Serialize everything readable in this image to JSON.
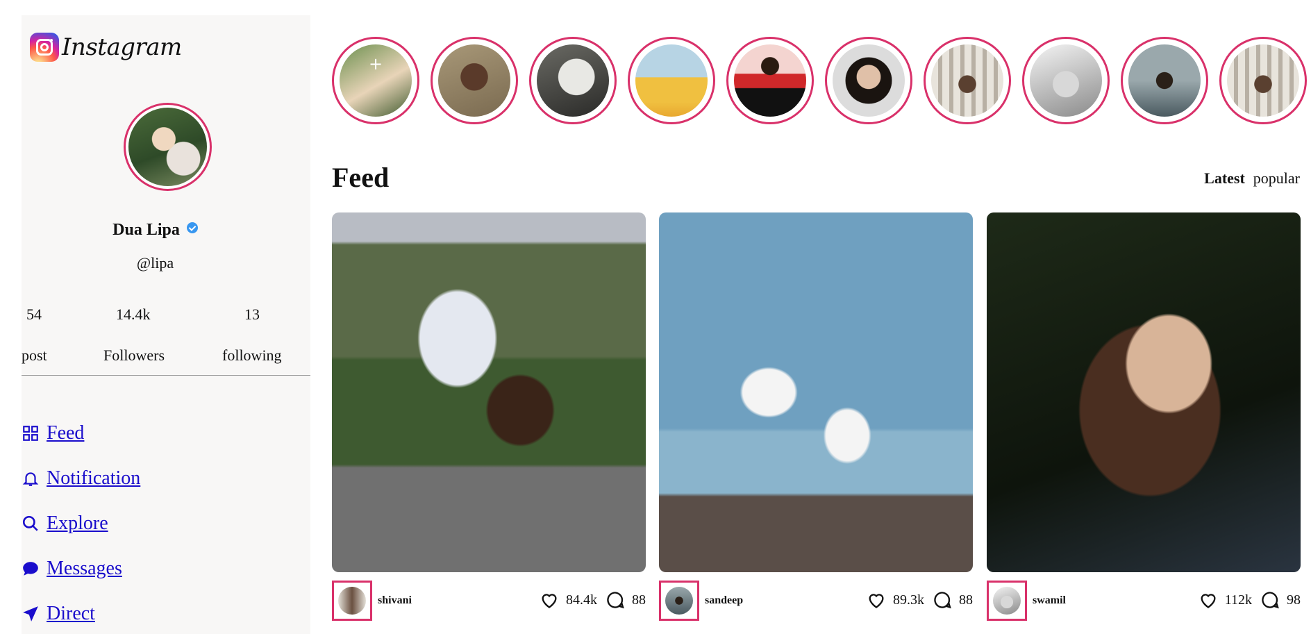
{
  "app": {
    "logo_text": "Instagram"
  },
  "profile": {
    "name": "Dua Lipa",
    "handle": "@lipa",
    "stats": [
      {
        "value": "54",
        "label": "post"
      },
      {
        "value": "14.4k",
        "label": "Followers"
      },
      {
        "value": "13",
        "label": "following"
      }
    ]
  },
  "nav": [
    {
      "label": "Feed",
      "icon": "grid-icon"
    },
    {
      "label": "Notification",
      "icon": "bell-icon"
    },
    {
      "label": "Explore",
      "icon": "search-icon"
    },
    {
      "label": "Messages",
      "icon": "chat-bubble-icon"
    },
    {
      "label": "Direct",
      "icon": "send-icon"
    }
  ],
  "stories_count": 10,
  "feed": {
    "title": "Feed",
    "tabs": [
      {
        "label": "Latest",
        "active": true
      },
      {
        "label": "popular",
        "active": false
      }
    ],
    "posts": [
      {
        "user": "shivani",
        "likes": "84.4k",
        "comments": "88"
      },
      {
        "user": "sandeep",
        "likes": "89.3k",
        "comments": "88"
      },
      {
        "user": "swamil",
        "likes": "112k",
        "comments": "98"
      }
    ]
  },
  "colors": {
    "story_ring": "#d9316a",
    "link": "#1a0dcc",
    "verified": "#3897f0"
  }
}
